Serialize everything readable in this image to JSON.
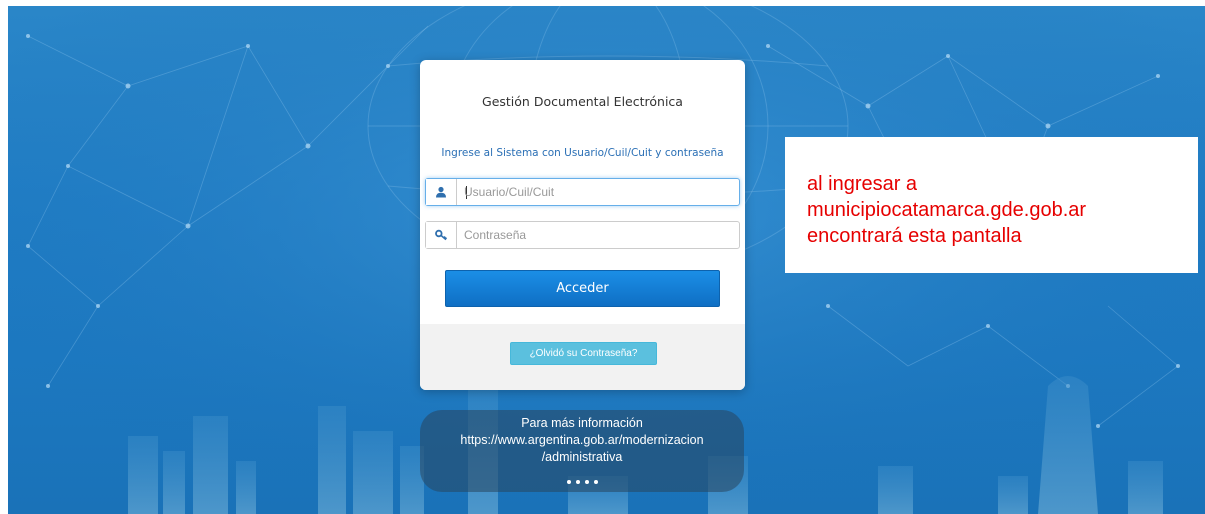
{
  "login": {
    "title": "Gestión Documental Electrónica",
    "subtitle": "Ingrese al Sistema con Usuario/Cuil/Cuit y contraseña",
    "username_placeholder": "Usuario/Cuil/Cuit",
    "username_value": "",
    "password_placeholder": "Contraseña",
    "password_value": "",
    "submit_label": "Acceder",
    "forgot_label": "¿Olvidó su Contraseña?",
    "username_icon": "user-icon",
    "password_icon": "key-icon"
  },
  "info": {
    "line1": "Para más información",
    "line2": "https://www.argentina.gob.ar/modernizacion",
    "line3": "/administrativa"
  },
  "annotation": {
    "line1": "al ingresar a",
    "line2": "municipiocatamarca.gde.gob.ar",
    "line3": "encontrará esta pantalla"
  },
  "colors": {
    "background": "#1f7cc4",
    "primary_button": "#1380d8",
    "info_button": "#5bc0de",
    "annotation_text": "#e60000",
    "subtitle_text": "#2a6fb5"
  }
}
